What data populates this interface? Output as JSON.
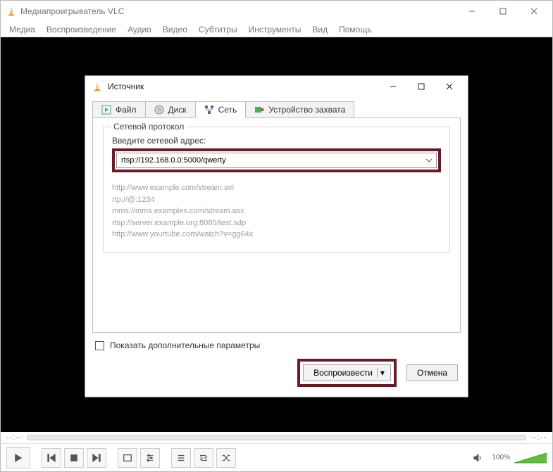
{
  "main": {
    "title": "Медиапроигрыватель VLC",
    "menu": [
      "Медиа",
      "Воспроизведение",
      "Аудио",
      "Видео",
      "Субтитры",
      "Инструменты",
      "Вид",
      "Помощь"
    ],
    "seek_left": "--:--",
    "seek_right": "--:--",
    "volume_pct": "100%"
  },
  "dialog": {
    "title": "Источник",
    "tabs": {
      "file": "Файл",
      "disc": "Диск",
      "net": "Сеть",
      "capture": "Устройство захвата"
    },
    "group_title": "Сетевой протокол",
    "url_label": "Введите сетевой адрес:",
    "url_value": "rtsp://192.168.0.0:5000/qwerty",
    "examples": [
      "http://www.example.com/stream.avi",
      "rtp://@:1234",
      "mms://mms.examples.com/stream.asx",
      "rtsp://server.example.org:8080/test.sdp",
      "http://www.yourtube.com/watch?v=gg64x"
    ],
    "show_more": "Показать дополнительные параметры",
    "play": "Воспроизвести",
    "cancel": "Отмена"
  }
}
